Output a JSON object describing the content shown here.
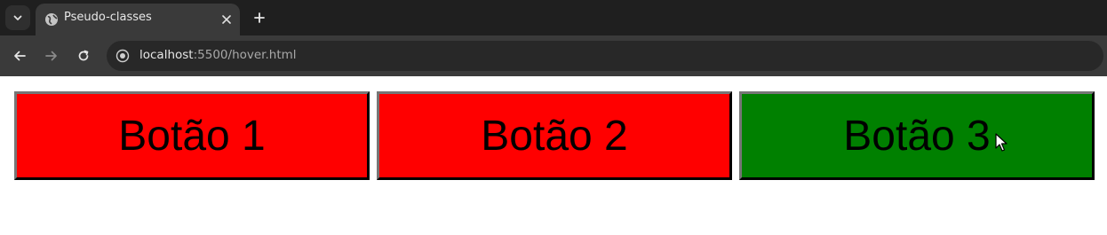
{
  "browser": {
    "tab": {
      "title": "Pseudo-classes"
    },
    "address": {
      "host": "localhost",
      "rest": ":5500/hover.html"
    }
  },
  "colors": {
    "button_default": "#ff0000",
    "button_hover": "#008000",
    "text": "#000000"
  },
  "icons": [
    "chevron-down-icon",
    "globe-icon",
    "close-icon",
    "plus-icon",
    "back-arrow-icon",
    "forward-arrow-icon",
    "reload-icon",
    "site-info-icon",
    "mouse-cursor-icon"
  ],
  "page": {
    "buttons": [
      {
        "label": "Botão 1",
        "state": "default"
      },
      {
        "label": "Botão 2",
        "state": "default"
      },
      {
        "label": "Botão 3",
        "state": "hover"
      }
    ]
  }
}
